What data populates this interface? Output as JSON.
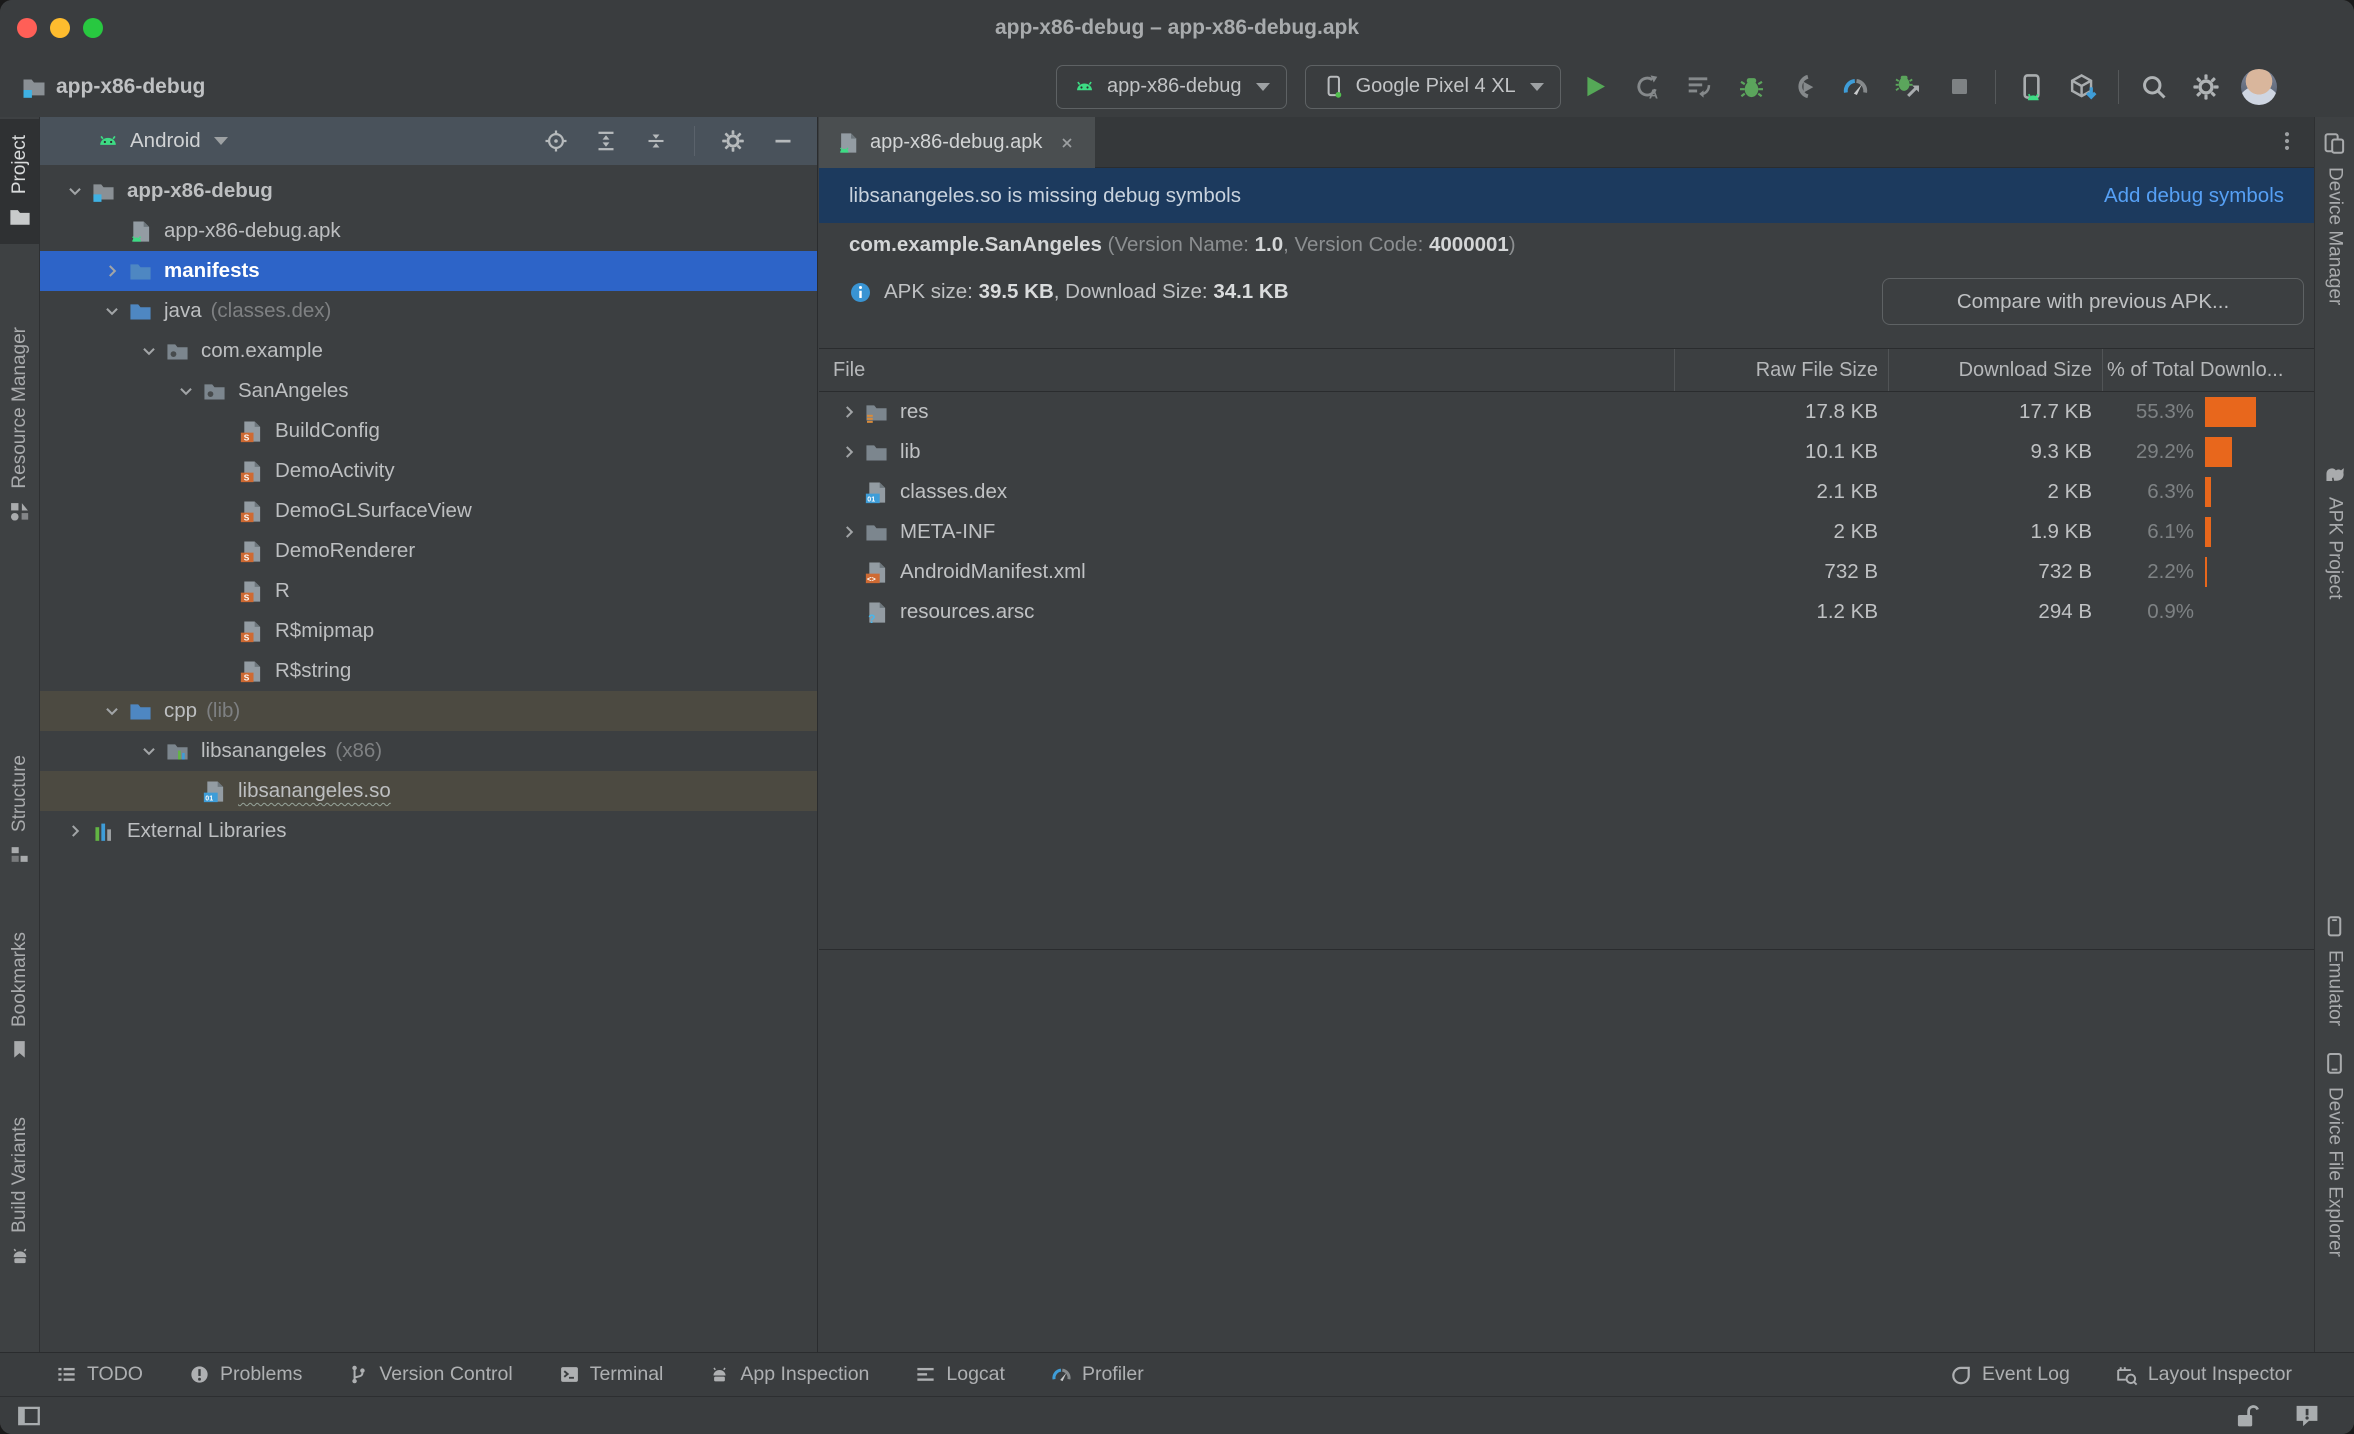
{
  "window": {
    "title": "app-x86-debug – app-x86-debug.apk"
  },
  "toolbar": {
    "project_name": "app-x86-debug",
    "run_config_label": "app-x86-debug",
    "device_label": "Google Pixel 4 XL"
  },
  "left_stripe": {
    "project": "Project",
    "resource_manager": "Resource Manager",
    "structure": "Structure",
    "bookmarks": "Bookmarks",
    "build_variants": "Build Variants"
  },
  "right_stripe": {
    "device_manager": "Device Manager",
    "apk_project": "APK Project",
    "emulator": "Emulator",
    "device_file_explorer": "Device File Explorer"
  },
  "project_panel": {
    "view_selector": "Android",
    "tree": {
      "items": [
        {
          "label": "app-x86-debug"
        },
        {
          "label": "app-x86-debug.apk"
        },
        {
          "label": "manifests"
        },
        {
          "label": "java",
          "suffix": "(classes.dex)"
        },
        {
          "label": "com.example"
        },
        {
          "label": "SanAngeles"
        },
        {
          "label": "BuildConfig"
        },
        {
          "label": "DemoActivity"
        },
        {
          "label": "DemoGLSurfaceView"
        },
        {
          "label": "DemoRenderer"
        },
        {
          "label": "R"
        },
        {
          "label": "R$mipmap"
        },
        {
          "label": "R$string"
        },
        {
          "label": "cpp",
          "suffix": "(lib)"
        },
        {
          "label": "libsanangeles",
          "suffix": "(x86)"
        },
        {
          "label": "libsanangeles.so"
        },
        {
          "label": "External Libraries"
        }
      ]
    }
  },
  "editor": {
    "tab_title": "app-x86-debug.apk",
    "banner": {
      "message": "libsanangeles.so is missing debug symbols",
      "action": "Add debug symbols"
    },
    "app_info": {
      "package": "com.example.SanAngeles",
      "pre_version": " (Version Name: ",
      "version_name": "1.0",
      "pre_code": ", Version Code: ",
      "version_code": "4000001",
      "post": ")"
    },
    "size_line": {
      "pre_apk": "APK size: ",
      "apk_size": "39.5 KB",
      "pre_download": ", Download Size: ",
      "download_size": "34.1 KB"
    },
    "compare_button": "Compare with previous APK...",
    "table": {
      "headers": {
        "file": "File",
        "raw": "Raw File Size",
        "download": "Download Size",
        "percent": "% of Total Downlo..."
      },
      "rows": [
        {
          "name": "res",
          "raw": "17.8 KB",
          "download": "17.7 KB",
          "percent": "55.3%",
          "pct": 55.3
        },
        {
          "name": "lib",
          "raw": "10.1 KB",
          "download": "9.3 KB",
          "percent": "29.2%",
          "pct": 29.2
        },
        {
          "name": "classes.dex",
          "raw": "2.1 KB",
          "download": "2 KB",
          "percent": "6.3%",
          "pct": 6.3
        },
        {
          "name": "META-INF",
          "raw": "2 KB",
          "download": "1.9 KB",
          "percent": "6.1%",
          "pct": 6.1
        },
        {
          "name": "AndroidManifest.xml",
          "raw": "732 B",
          "download": "732 B",
          "percent": "2.2%",
          "pct": 2.2
        },
        {
          "name": "resources.arsc",
          "raw": "1.2 KB",
          "download": "294 B",
          "percent": "0.9%",
          "pct": 0.9
        }
      ]
    }
  },
  "bottom_bar": {
    "todo": "TODO",
    "problems": "Problems",
    "version_control": "Version Control",
    "terminal": "Terminal",
    "app_inspection": "App Inspection",
    "logcat": "Logcat",
    "profiler": "Profiler",
    "event_log": "Event Log",
    "layout_inspector": "Layout Inspector"
  },
  "icon_names": [
    "module-folder-icon",
    "apk-file-icon",
    "folder-icon",
    "package-icon",
    "class-file-icon",
    "binary-file-icon",
    "xml-file-icon",
    "arsc-file-icon",
    "library-folder-icon",
    "external-libraries-icon",
    "android-icon",
    "locate-file-icon",
    "expand-all-icon",
    "collapse-all-icon",
    "gear-icon",
    "hide-icon",
    "chevron-right-icon",
    "chevron-down-icon",
    "close-icon",
    "info-icon",
    "run-icon",
    "apply-changes-icon",
    "apply-code-changes-icon",
    "debug-icon",
    "attach-debugger-icon",
    "profiler-icon",
    "profile-low-overhead-icon",
    "stop-icon",
    "device-mirroring-icon",
    "sdk-manager-icon",
    "search-icon",
    "settings-icon",
    "avatar",
    "phone-icon",
    "todo-icon",
    "problems-icon",
    "version-control-icon",
    "terminal-icon",
    "app-inspection-icon",
    "logcat-icon",
    "event-log-icon",
    "layout-inspector-icon",
    "unlock-icon",
    "notification-icon",
    "window-toggle-icon",
    "device-manager-icon",
    "apk-project-icon",
    "emulator-icon",
    "device-file-explorer-icon",
    "resource-manager-icon",
    "structure-icon",
    "bookmarks-icon",
    "build-variants-icon",
    "more-options-icon"
  ],
  "colors": {
    "selection_blue": "#2D64C8",
    "row_olive": "#4C4A41",
    "bar_orange": "#E8671C",
    "banner_blue": "#1C3A5E",
    "link_blue": "#56A0F5",
    "android_green": "#3DDC84",
    "traffic_red": "#FF5F57",
    "traffic_yellow": "#FEBC2E",
    "traffic_green": "#28C840"
  }
}
